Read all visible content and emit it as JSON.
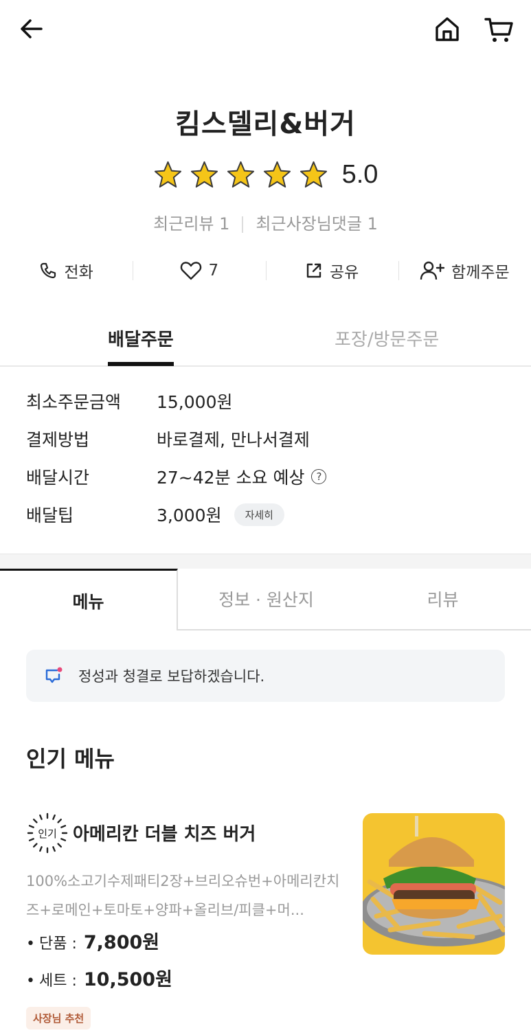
{
  "header": {
    "back_icon": "arrow-left-icon",
    "home_icon": "home-icon",
    "cart_icon": "cart-icon"
  },
  "store": {
    "name": "킴스델리&버거",
    "rating": "5.0",
    "stars": 5,
    "recent_reviews": "최근리뷰 1",
    "recent_owner_replies": "최근사장님댓글 1"
  },
  "actions": {
    "call": "전화",
    "likes": "7",
    "share": "공유",
    "group_order": "함께주문"
  },
  "order_tabs": {
    "delivery": "배달주문",
    "pickup": "포장/방문주문"
  },
  "info": {
    "min_order_label": "최소주문금액",
    "min_order_value": "15,000원",
    "payment_label": "결제방법",
    "payment_value": "바로결제, 만나서결제",
    "time_label": "배달시간",
    "time_value": "27~42분 소요 예상",
    "tip_label": "배달팁",
    "tip_value": "3,000원",
    "tip_detail": "자세히"
  },
  "content_tabs": {
    "menu": "메뉴",
    "info": "정보 · 원산지",
    "reviews": "리뷰"
  },
  "notice": "정성과 청결로 보답하겠습니다.",
  "popular": {
    "title": "인기 메뉴",
    "badge": "인기",
    "item": {
      "name": "아메리칸 더블 치즈 버거",
      "desc": "100%소고기수제패티2장+브리오슈번+아메리칸치즈+로메인+토마토+양파+올리브/피클+머...",
      "single_label": "단품 :",
      "single_price": "7,800원",
      "set_label": "세트 :",
      "set_price": "10,500원",
      "recommend": "사장님 추천"
    }
  },
  "colors": {
    "star": "#F5C518",
    "accent": "#111111",
    "photo_bg": "#F4C430",
    "notice_dot": "#E84A7A",
    "notice_icon": "#2A6BD8"
  }
}
